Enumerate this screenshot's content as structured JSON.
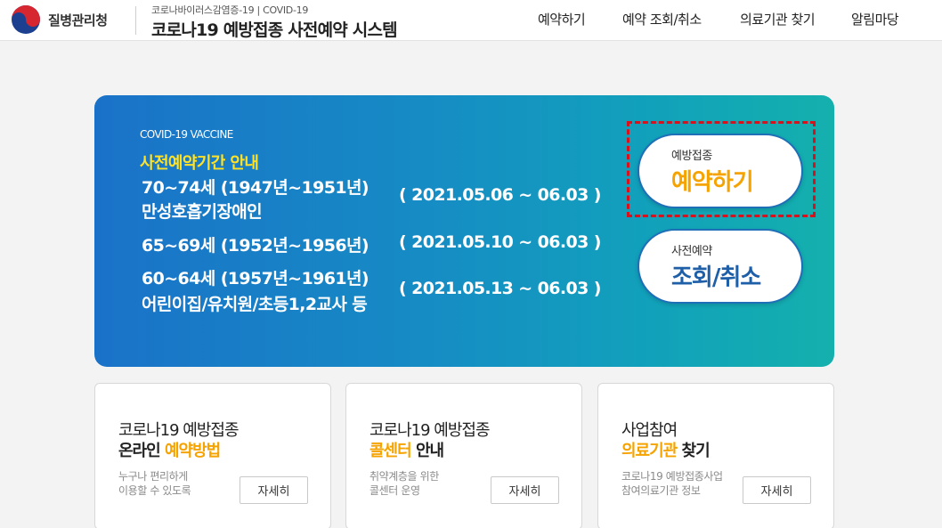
{
  "header": {
    "agency_name": "질병관리청",
    "subtitle": "코로나바이러스감염증-19 | COVID-19",
    "title": "코로나19 예방접종 사전예약 시스템",
    "nav": [
      "예약하기",
      "예약 조회/취소",
      "의료기관 찾기",
      "알림마당"
    ]
  },
  "hero": {
    "tag": "COVID-19 VACCINE",
    "period_title": "사전예약기간 안내",
    "groups": [
      {
        "label_lines": [
          "70~74세 (1947년~1951년)",
          "만성호흡기장애인"
        ],
        "range": "( 2021.05.06 ~ 06.03 )"
      },
      {
        "label_lines": [
          "65~69세 (1952년~1956년)"
        ],
        "range": "( 2021.05.10 ~ 06.03 )"
      },
      {
        "label_lines": [
          "60~64세 (1957년~1961년)",
          "어린이집/유치원/초등1,2교사 등"
        ],
        "range": "( 2021.05.13 ~ 06.03 )"
      }
    ],
    "buttons": {
      "reserve": {
        "small": "예방접종",
        "big": "예약하기"
      },
      "lookup": {
        "small": "사전예약",
        "big": "조회/취소"
      }
    }
  },
  "cards": [
    {
      "line1": "코로나19 예방접종",
      "line2_accent": "예약방법",
      "line2_prefix": "온라인 ",
      "line2_suffix": "",
      "desc": [
        "누구나 편리하게",
        "이용할 수 있도록"
      ],
      "button": "자세히"
    },
    {
      "line1": "코로나19 예방접종",
      "line2_accent": "콜센터",
      "line2_prefix": "",
      "line2_suffix": " 안내",
      "desc": [
        "취약계층을 위한",
        "콜센터 운영"
      ],
      "button": "자세히"
    },
    {
      "line1": "사업참여",
      "line2_accent": "의료기관",
      "line2_prefix": "",
      "line2_suffix": " 찾기",
      "desc": [
        "코로나19 예방접종사업",
        "참여의료기관 정보"
      ],
      "button": "자세히"
    }
  ],
  "colors": {
    "accent_yellow": "#ffe226",
    "accent_orange": "#f5a300",
    "reserve_text": "#f5a300",
    "lookup_text": "#1e5fa8",
    "highlight_border": "#d8111d"
  }
}
